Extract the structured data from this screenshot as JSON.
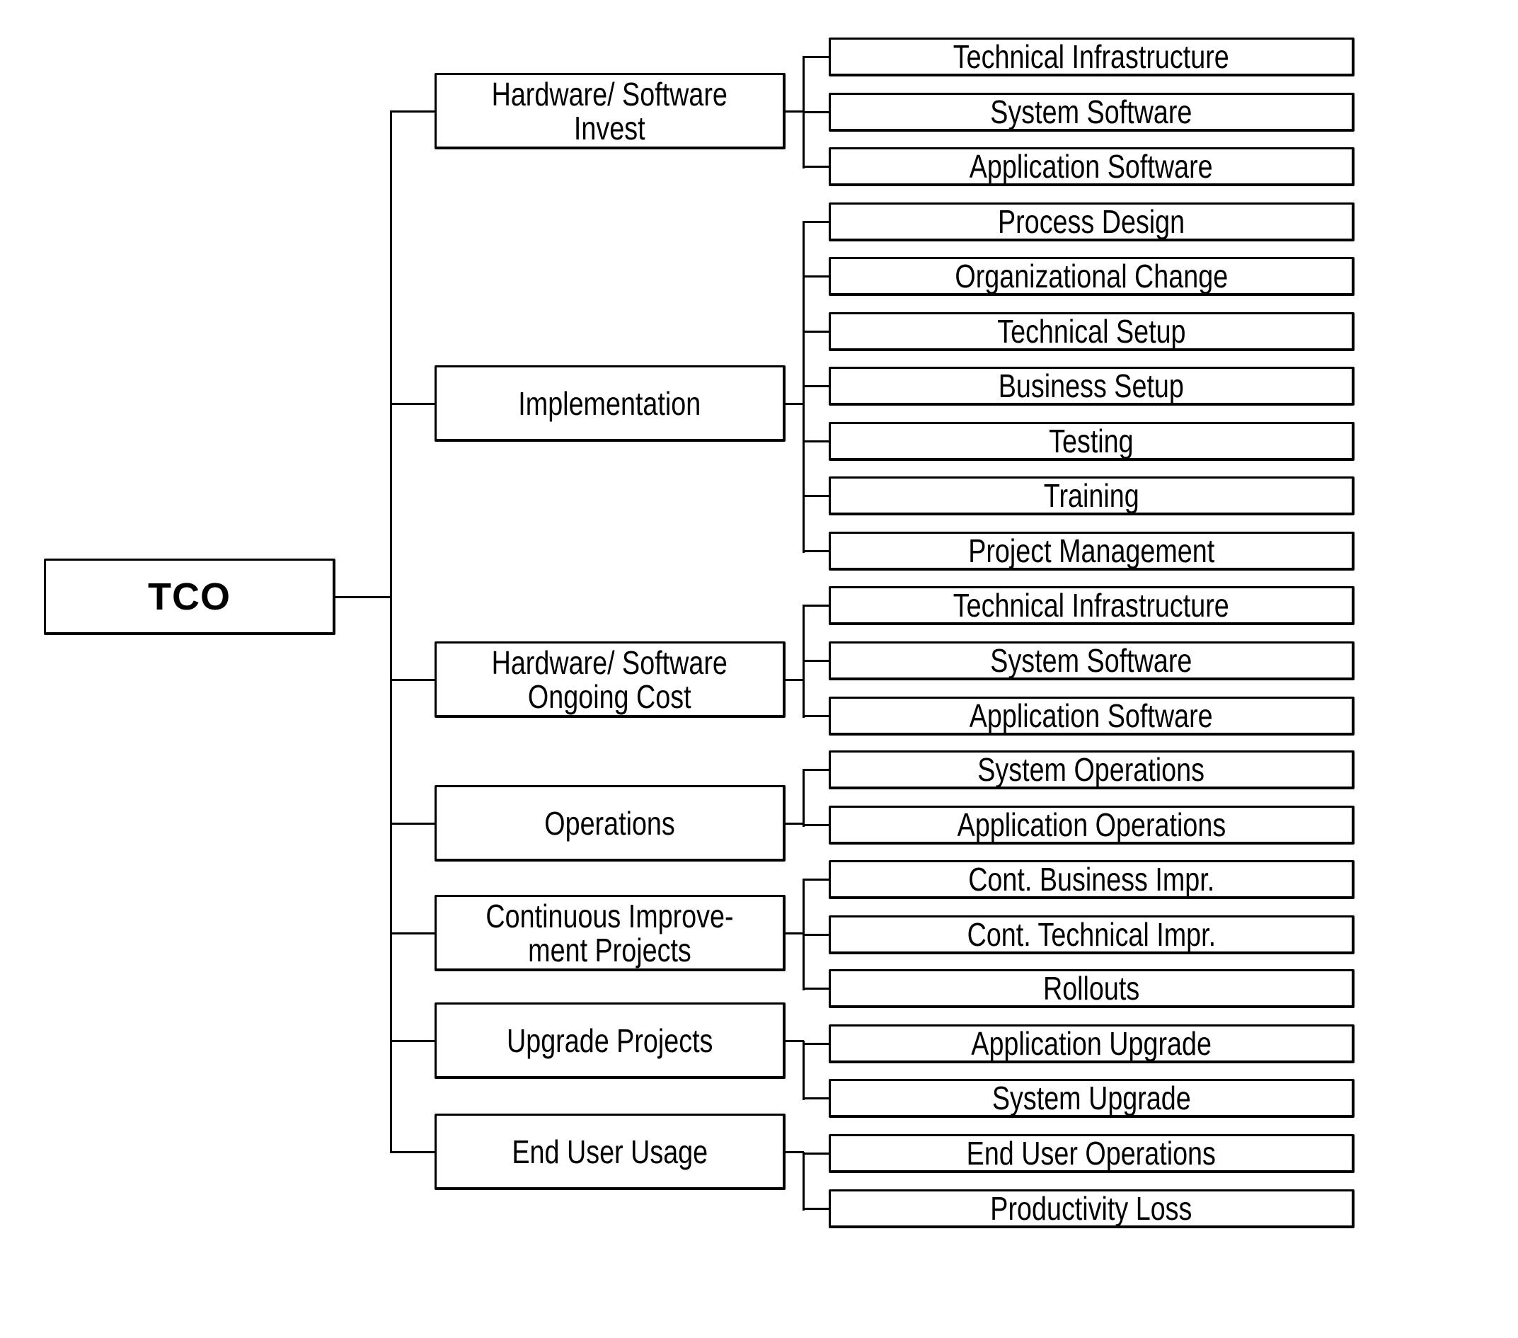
{
  "diagram": {
    "root": {
      "label": "TCO"
    },
    "categories": [
      {
        "label": "Hardware/ Software\nInvest",
        "children": [
          "Technical Infrastructure",
          "System Software",
          "Application Software"
        ]
      },
      {
        "label": "Implementation",
        "children": [
          "Process Design",
          "Organizational Change",
          "Technical Setup",
          "Business Setup",
          "Testing",
          "Training",
          "Project Management"
        ]
      },
      {
        "label": "Hardware/ Software\nOngoing Cost",
        "children": [
          "Technical Infrastructure",
          "System Software",
          "Application Software"
        ]
      },
      {
        "label": "Operations",
        "children": [
          "System Operations",
          "Application Operations"
        ]
      },
      {
        "label": "Continuous Improve-\nment Projects",
        "children": [
          "Cont. Business Impr.",
          "Cont. Technical Impr.",
          "Rollouts"
        ]
      },
      {
        "label": "Upgrade Projects",
        "children": [
          "Application Upgrade",
          "System Upgrade"
        ]
      },
      {
        "label": "End User Usage",
        "children": [
          "End User Operations",
          "Productivity Loss"
        ]
      }
    ]
  }
}
